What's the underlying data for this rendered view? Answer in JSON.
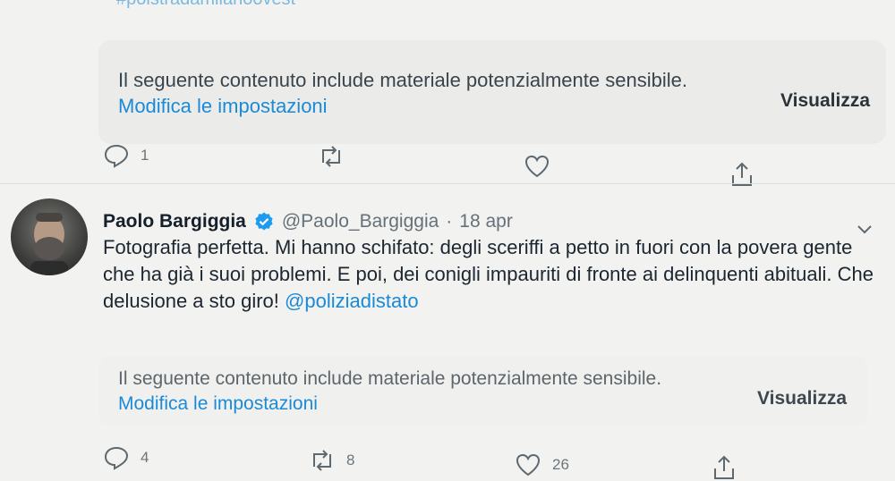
{
  "previous_tweet": {
    "hashtag_partial": "#polstradamilanoovest",
    "sensitive_warning": {
      "text": "Il seguente contenuto include materiale potenzialmente sensibile.",
      "settings_link": "Modifica le impostazioni",
      "view_label": "Visualizza"
    },
    "actions": {
      "reply_count": "1",
      "retweet_count": "",
      "like_count": ""
    }
  },
  "tweet": {
    "author_name": "Paolo Bargiggia",
    "handle": "@Paolo_Bargiggia",
    "separator": "·",
    "date": "18 apr",
    "text": "Fotografia perfetta.  Mi hanno schifato: degli sceriffi a petto in fuori con la povera gente che ha già i suoi problemi. E poi, dei conigli impauriti di fronte ai delinquenti abituali. Che delusione a sto giro! ",
    "mention": "@poliziadistato",
    "sensitive_warning": {
      "text": "Il seguente contenuto include materiale potenzialmente sensibile.",
      "settings_link": "Modifica le impostazioni",
      "view_label": "Visualizza"
    },
    "actions": {
      "reply_count": "4",
      "retweet_count": "8",
      "like_count": "26"
    }
  },
  "colors": {
    "link": "#1b8ad6",
    "verified": "#1d9bf0",
    "background": "#f2f2f0"
  },
  "icons": [
    "reply-icon",
    "retweet-icon",
    "like-icon",
    "share-icon",
    "verified-icon",
    "chevron-down-icon"
  ]
}
